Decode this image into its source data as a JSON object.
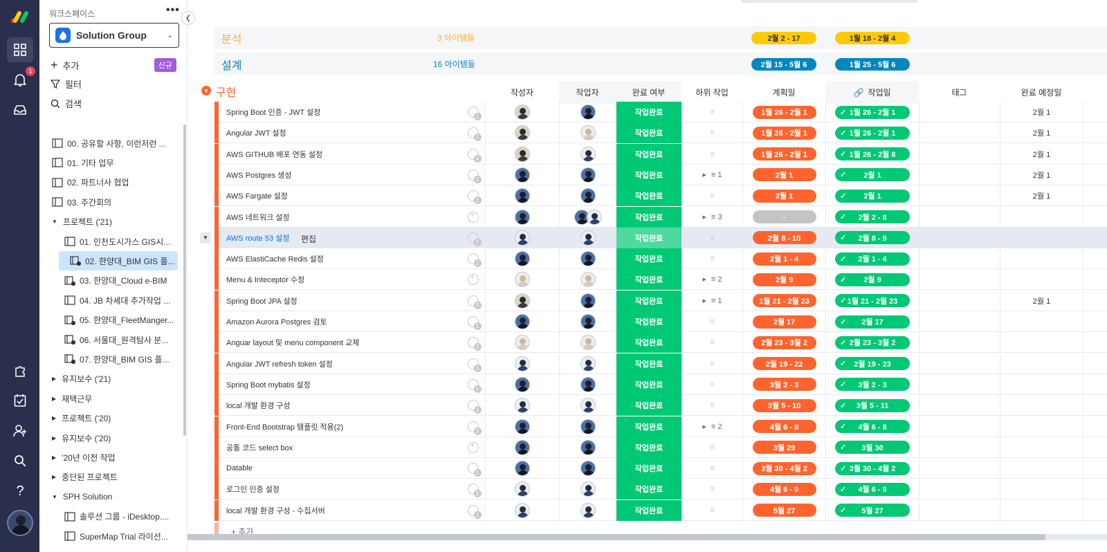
{
  "rail": {
    "notif_count": "1"
  },
  "sidebar": {
    "workspace_label": "워크스페이스",
    "workspace_name": "Solution Group",
    "add_label": "추가",
    "new_badge": "신규",
    "filter_label": "필터",
    "search_label": "검색",
    "tree": [
      {
        "label": "00. 공유할 사항, 이런저런 ...",
        "icon": "board",
        "level": 1
      },
      {
        "label": "01. 기타 업무",
        "icon": "board",
        "level": 1
      },
      {
        "label": "02. 파트너사 협업",
        "icon": "board",
        "level": 1
      },
      {
        "label": "03. 주간회의",
        "icon": "board",
        "level": 1
      },
      {
        "label": "프로젝트 ('21)",
        "icon": "folder-open",
        "level": 0
      },
      {
        "label": "01. 인천도시가스 GIS시...",
        "icon": "board",
        "level": 2
      },
      {
        "label": "02. 한양대_BIM GIS 플...",
        "icon": "shared-board",
        "level": 2,
        "selected": true
      },
      {
        "label": "03. 한양대_Cloud e-BIM",
        "icon": "shared-board",
        "level": 2
      },
      {
        "label": "04. JB 차세대 추가작업 ...",
        "icon": "board",
        "level": 2
      },
      {
        "label": "05. 한양대_FleetManger...",
        "icon": "shared-board",
        "level": 2
      },
      {
        "label": "06. 서울대_원격탐사 분...",
        "icon": "shared-board",
        "level": 2
      },
      {
        "label": "07. 한양대_BIM GIS 플...",
        "icon": "shared-board",
        "level": 2
      },
      {
        "label": "유지보수 ('21)",
        "icon": "folder-closed",
        "level": 0
      },
      {
        "label": "재택근무",
        "icon": "folder-closed",
        "level": 0
      },
      {
        "label": "프로젝트 ('20)",
        "icon": "folder-closed",
        "level": 0
      },
      {
        "label": "유지보수 ('20)",
        "icon": "folder-closed",
        "level": 0
      },
      {
        "label": "'20년 이전 작업",
        "icon": "folder-closed",
        "level": 0
      },
      {
        "label": "중단된 프로젝트",
        "icon": "folder-closed",
        "level": 0
      },
      {
        "label": "SPH Solution",
        "icon": "folder-open",
        "level": 0
      },
      {
        "label": "솔루션 그룹 - iDesktop....",
        "icon": "board",
        "level": 2
      },
      {
        "label": "SuperMap Trial 라이선...",
        "icon": "board",
        "level": 2
      }
    ]
  },
  "groups": [
    {
      "title": "분석",
      "count": "3 아이템들",
      "color": "#fdab3d",
      "plan": "2월 2 - 17",
      "plan_color": "#ffcb00",
      "work": "1월 18 - 2월 4",
      "work_color": "#ffcb00"
    },
    {
      "title": "설계",
      "count": "16 아이템들",
      "color": "#0086c0",
      "plan": "2월 15 - 5월 6",
      "plan_color": "#0086c0",
      "work": "1월 25 - 5월 6",
      "work_color": "#0086c0"
    }
  ],
  "board": {
    "group_title": "구현",
    "group_color": "#e2445c",
    "headers": {
      "author": "작성자",
      "worker": "작업자",
      "status": "완료 여부",
      "subtask": "하위 작업",
      "plan": "계획일",
      "work": "작업일",
      "tag": "태그",
      "due": "완료 예정일"
    },
    "edit_label": "편집",
    "add_label": "+ 추가",
    "rows": [
      {
        "name": "Spring Boot 인증 - JWT 설정",
        "chat": "1",
        "author": "p1",
        "worker": "p2",
        "status": "작업완료",
        "sub": "",
        "plan": "1월 26 - 2월 1",
        "work": "1월 26 - 2월 1",
        "due": "2월 1"
      },
      {
        "name": "Angular JWT 설정",
        "chat": "1",
        "author": "p1",
        "worker": "p3",
        "status": "작업완료",
        "sub": "",
        "plan": "1월 26 - 2월 1",
        "work": "1월 26 - 2월 1",
        "due": "2월 1"
      },
      {
        "name": "AWS GITHUB 배포 연동 설정",
        "chat": "4",
        "author": "p1",
        "worker": "p4",
        "status": "작업완료",
        "sub": "",
        "plan": "1월 26 - 2월 1",
        "work": "1월 26 - 2월 8",
        "due": "2월 1"
      },
      {
        "name": "AWS Postgres 생성",
        "chat": "2",
        "author": "p2",
        "worker": "p2",
        "status": "작업완료",
        "sub": "1",
        "plan": "2월 1",
        "work": "2월 1",
        "due": "2월 1"
      },
      {
        "name": "AWS Fargate 설정",
        "chat": "1",
        "author": "p2",
        "worker": "p2",
        "status": "작업완료",
        "sub": "",
        "plan": "2월 1",
        "work": "2월 1",
        "due": "2월 1"
      },
      {
        "name": "AWS 네트워크 설정",
        "chat": "+",
        "author": "p2",
        "worker": "p2p4",
        "status": "작업완료",
        "sub": "3",
        "plan": "-",
        "work": "2월 2 - 8",
        "due": ""
      },
      {
        "name": "AWS route 53 설정",
        "chat": "2",
        "author": "p4",
        "worker": "p4",
        "status": "작업완료",
        "sub": "",
        "plan": "2월 8 - 10",
        "work": "2월 8 - 9",
        "due": "",
        "highlight": true
      },
      {
        "name": "AWS ElastiCache Redis 설정",
        "chat": "1",
        "author": "p2",
        "worker": "p2",
        "status": "작업완료",
        "sub": "",
        "plan": "2월 1 - 4",
        "work": "2월 1 - 4",
        "due": ""
      },
      {
        "name": "Menu & Inteceptor 수정",
        "chat": "+",
        "author": "p3",
        "worker": "p3",
        "status": "작업완료",
        "sub": "2",
        "plan": "2월 9",
        "work": "2월 9",
        "due": ""
      },
      {
        "name": "Spring Boot JPA 설정",
        "chat": "2",
        "author": "p1",
        "worker": "p2",
        "status": "작업완료",
        "sub": "1",
        "plan": "1월 21 - 2월 23",
        "work": "1월 21 - 2월 23",
        "due": "2월 1"
      },
      {
        "name": "Amazon Aurora Postgres 검토",
        "chat": "1",
        "author": "p2",
        "worker": "p2",
        "status": "작업완료",
        "sub": "",
        "plan": "2월 17",
        "work": "2월 17",
        "due": ""
      },
      {
        "name": "Anguar layout 및 menu component 교체",
        "chat": "2",
        "author": "p3",
        "worker": "p3",
        "status": "작업완료",
        "sub": "",
        "plan": "2월 23 - 3월 2",
        "work": "2월 23 - 3월 2",
        "due": ""
      },
      {
        "name": "Angular JWT refresh token 설정",
        "chat": "1",
        "author": "p4",
        "worker": "p4",
        "status": "작업완료",
        "sub": "",
        "plan": "2월 19 - 22",
        "work": "2월 19 - 23",
        "due": ""
      },
      {
        "name": "Spring Boot mybatis 설정",
        "chat": "1",
        "author": "p2",
        "worker": "p2",
        "status": "작업완료",
        "sub": "",
        "plan": "3월 2 - 3",
        "work": "3월 2 - 3",
        "due": ""
      },
      {
        "name": "local 개발 환경 구성",
        "chat": "1",
        "author": "p4",
        "worker": "p4",
        "status": "작업완료",
        "sub": "",
        "plan": "3월 5 - 10",
        "work": "3월 5 - 11",
        "due": ""
      },
      {
        "name": "Front-End Bootstrap 템플릿 적용(2)",
        "chat": "3",
        "author": "p2",
        "worker": "p2",
        "status": "작업완료",
        "sub": "2",
        "plan": "4월 6 - 8",
        "work": "4월 6 - 8",
        "due": ""
      },
      {
        "name": "공통 코드 select box",
        "chat": "+",
        "author": "p2",
        "worker": "p2",
        "status": "작업완료",
        "sub": "",
        "plan": "3월 29",
        "work": "3월 30",
        "due": ""
      },
      {
        "name": "Datable",
        "chat": "1",
        "author": "p2",
        "worker": "p2",
        "status": "작업완료",
        "sub": "",
        "plan": "3월 30 - 4월 2",
        "work": "3월 30 - 4월 2",
        "due": ""
      },
      {
        "name": "로그인 인증 설정",
        "chat": "2",
        "author": "p4",
        "worker": "p4",
        "status": "작업완료",
        "sub": "",
        "plan": "4월 6 - 9",
        "work": "4월 6 - 9",
        "due": ""
      },
      {
        "name": "local 개발 환경 구성 - 수집서버",
        "chat": "1",
        "author": "p4",
        "worker": "p4",
        "status": "작업완료",
        "sub": "",
        "plan": "5월 27",
        "work": "5월 27",
        "due": ""
      }
    ]
  },
  "colors": {
    "plan": "#ff642e",
    "plan_empty": "#c4c4c4",
    "done": "#00c875",
    "link": "#0073ea"
  }
}
